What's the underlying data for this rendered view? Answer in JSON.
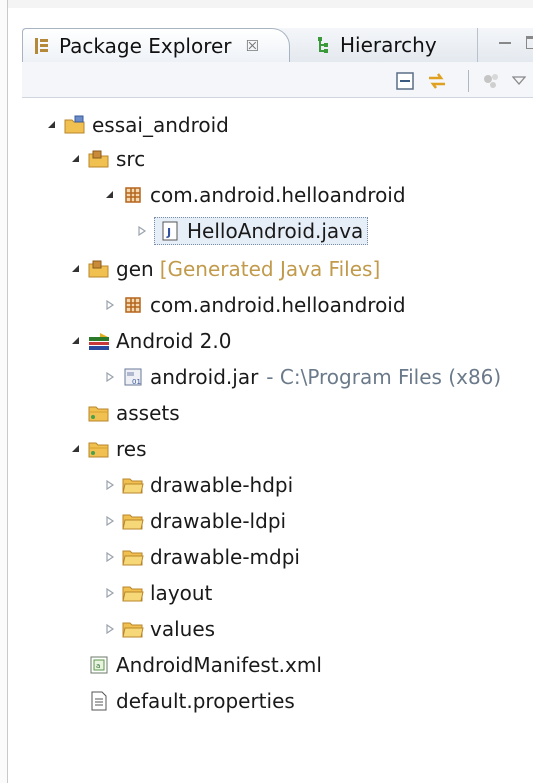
{
  "tabs": {
    "active": {
      "label": "Package Explorer",
      "close": "☒",
      "icon": "package-explorer-icon"
    },
    "inactive": {
      "label": "Hierarchy",
      "icon": "hierarchy-icon"
    }
  },
  "toolbar": {
    "buttons": [
      "collapse-all-icon",
      "link-with-editor-icon",
      "customize-view-icon",
      "view-menu-icon"
    ]
  },
  "tree": {
    "project": "essai_android",
    "src": "src",
    "package": "com.android.helloandroid",
    "java_file": "HelloAndroid.java",
    "gen": "gen",
    "gen_decoration": "[Generated Java Files]",
    "gen_package": "com.android.helloandroid",
    "android_lib": "Android 2.0",
    "android_jar": "android.jar",
    "android_jar_path": "- C:\\Program Files (x86)",
    "assets": "assets",
    "res": "res",
    "res_items": [
      "drawable-hdpi",
      "drawable-ldpi",
      "drawable-mdpi",
      "layout",
      "values"
    ],
    "manifest": "AndroidManifest.xml",
    "properties": "default.properties"
  },
  "colors": {
    "selection_bg": "#e6eef8",
    "decoration": "#c19a4b",
    "folder": "#e8b640",
    "package": "#b5651d"
  }
}
